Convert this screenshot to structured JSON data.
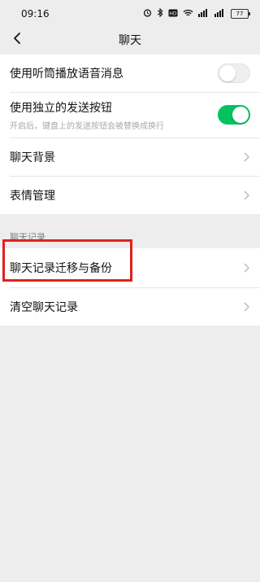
{
  "status_bar": {
    "time": "09:16",
    "battery": "77",
    "icons": [
      "alarm-icon",
      "bluetooth-icon",
      "hd-icon",
      "wifi-icon",
      "signal-icon",
      "signal-icon",
      "battery-icon"
    ]
  },
  "nav": {
    "title": "聊天",
    "back_icon": "chevron-left-icon"
  },
  "settings_group1": {
    "items": [
      {
        "label": "使用听筒播放语音消息",
        "control": "toggle",
        "state": "off"
      },
      {
        "label": "使用独立的发送按钮",
        "description": "开启后，键盘上的发送按钮会被替换成换行",
        "control": "toggle",
        "state": "on"
      },
      {
        "label": "聊天背景",
        "control": "chevron"
      },
      {
        "label": "表情管理",
        "control": "chevron"
      }
    ]
  },
  "chat_history_section": {
    "header": "聊天记录",
    "items": [
      {
        "label": "聊天记录迁移与备份",
        "control": "chevron",
        "highlighted": true
      },
      {
        "label": "清空聊天记录",
        "control": "chevron"
      }
    ]
  },
  "colors": {
    "accent_green": "#07c160",
    "highlight_red": "#e02020",
    "background": "#ededed"
  }
}
